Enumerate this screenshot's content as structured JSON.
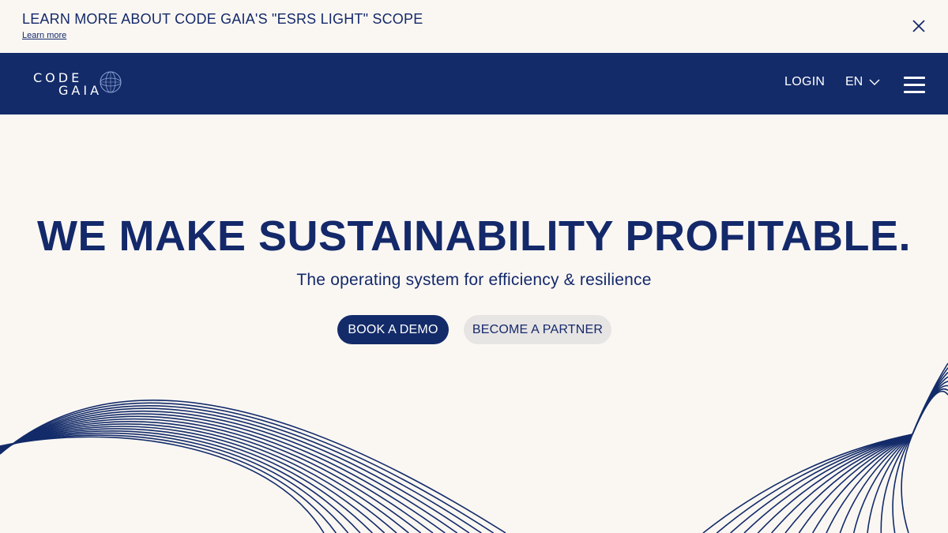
{
  "banner": {
    "title": "LEARN MORE ABOUT CODE GAIA'S \"ESRS LIGHT\" SCOPE",
    "link_label": "Learn more",
    "close_icon": "close-icon"
  },
  "nav": {
    "logo_line1": "CODE",
    "logo_line2": "GAIA",
    "login_label": "LOGIN",
    "language": "EN",
    "language_icon": "chevron-down-icon",
    "menu_icon": "hamburger-menu-icon"
  },
  "hero": {
    "headline": "WE MAKE SUSTAINABILITY PROFITABLE.",
    "subtitle": "The operating system for efficiency & resilience",
    "primary_cta": "BOOK A DEMO",
    "secondary_cta": "BECOME A PARTNER"
  },
  "colors": {
    "background": "#faf7f3",
    "navy": "#132b69",
    "secondary_button": "#e7e4e4",
    "white": "#ffffff"
  }
}
